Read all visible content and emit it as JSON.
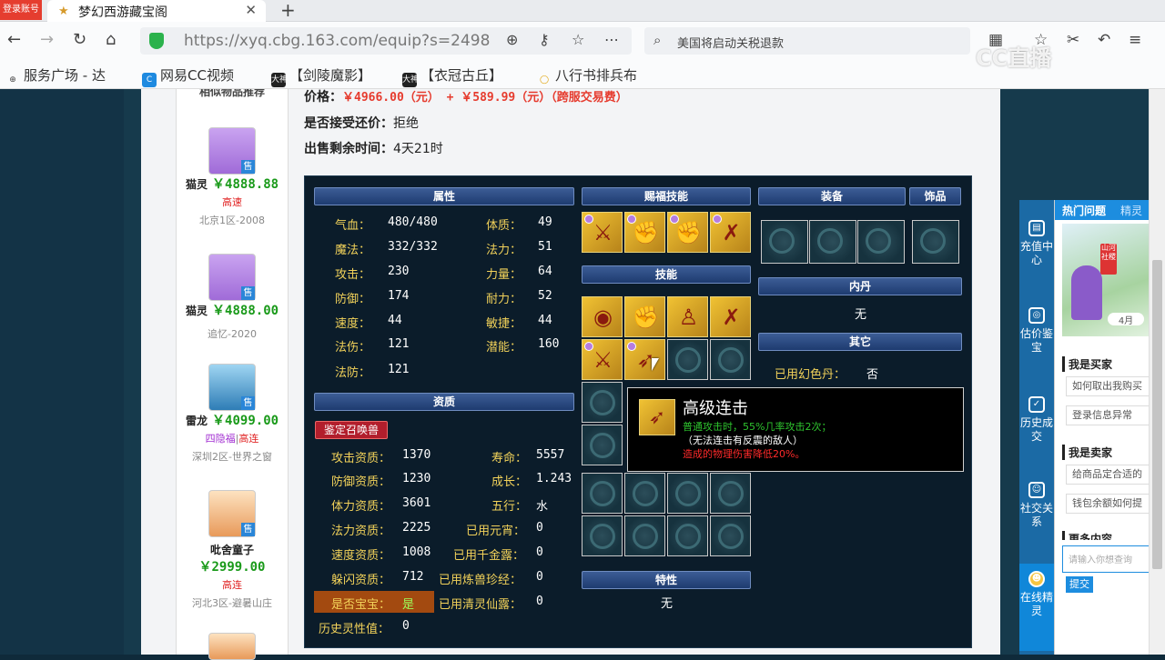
{
  "browser": {
    "corner_badge": "登录账号",
    "tab_title": "梦幻西游藏宝阁",
    "url": "https://xyq.cbg.163.com/equip?s=2498",
    "search_text": "美国将启动关税退款",
    "bookmarks": [
      "服务广场 - 达",
      "网易CC视频",
      "【剑陵魔影】",
      "【衣冠古丘】",
      "八行书排兵布"
    ],
    "bookmark_badge": "大神",
    "watermark": "CC直播"
  },
  "recommend": {
    "heading": "相似物品推荐",
    "sell_badge": "售",
    "items": [
      {
        "name": "猫灵",
        "price": "￥4888.88",
        "tag": "高速",
        "server": "北京1区-2008"
      },
      {
        "name": "猫灵",
        "price": "￥4888.00",
        "tag": "",
        "server": "追忆-2020"
      },
      {
        "name": "雷龙",
        "price": "￥4099.00",
        "tag_purple": "四隐福",
        "tag_sep": "|",
        "tag": "高连",
        "server": "深圳2区-世界之窗"
      },
      {
        "name": "吡舍童子",
        "price": "￥2999.00",
        "tag": "高连",
        "server": "河北3区-避暑山庄"
      }
    ]
  },
  "listing": {
    "price_label": "价格：",
    "price": "￥4966.00（元） + ￥589.99（元）（跨服交易费）",
    "counter_label": "是否接受还价：",
    "counter_value": "拒绝",
    "time_label": "出售剩余时间：",
    "time_value": "4天21时"
  },
  "panel": {
    "headers": {
      "attr": "属性",
      "gift_skills": "赐福技能",
      "equip": "装备",
      "ornament": "饰品",
      "skills": "技能",
      "neidan": "内丹",
      "other": "其它",
      "aptitude": "资质",
      "spirit": "特性"
    },
    "neidan_value": "无",
    "other_label": "已用幻色丹：",
    "other_value": "否",
    "spirit_value": "无",
    "summon_button": "鉴定召唤兽",
    "attrs_left": [
      {
        "label": "气血：",
        "value": "480/480"
      },
      {
        "label": "魔法：",
        "value": "332/332"
      },
      {
        "label": "攻击：",
        "value": "230"
      },
      {
        "label": "防御：",
        "value": "174"
      },
      {
        "label": "速度：",
        "value": "44"
      },
      {
        "label": "法伤：",
        "value": "121"
      },
      {
        "label": "法防：",
        "value": "121"
      }
    ],
    "attrs_right": [
      {
        "label": "体质：",
        "value": "49"
      },
      {
        "label": "法力：",
        "value": "51"
      },
      {
        "label": "力量：",
        "value": "64"
      },
      {
        "label": "耐力：",
        "value": "52"
      },
      {
        "label": "敏捷：",
        "value": "44"
      },
      {
        "label": "潜能：",
        "value": "160"
      }
    ],
    "apt_left": [
      {
        "label": "攻击资质：",
        "value": "1370"
      },
      {
        "label": "防御资质：",
        "value": "1230"
      },
      {
        "label": "体力资质：",
        "value": "3601"
      },
      {
        "label": "法力资质：",
        "value": "2225"
      },
      {
        "label": "速度资质：",
        "value": "1008"
      },
      {
        "label": "躲闪资质：",
        "value": "712"
      },
      {
        "label": "是否宝宝：",
        "value": "是"
      },
      {
        "label": "历史灵性值：",
        "value": "0"
      }
    ],
    "apt_right": [
      {
        "label": "寿命：",
        "value": "5557"
      },
      {
        "label": "成长：",
        "value": "1.243"
      },
      {
        "label": "五行：",
        "value": "水"
      },
      {
        "label": "已用元宵：",
        "value": "0"
      },
      {
        "label": "已用千金露：",
        "value": "0"
      },
      {
        "label": "已用炼兽珍经：",
        "value": "0"
      },
      {
        "label": "已用清灵仙露：",
        "value": "0"
      }
    ]
  },
  "tooltip": {
    "title": "高级连击",
    "line1": "普通攻击时，55%几率攻击2次；",
    "line2": "（无法连击有反震的敌人）",
    "line3": "造成的物理伤害降低20%。"
  },
  "sidenav": [
    {
      "label": "充值中心",
      "icon": "recharge-icon"
    },
    {
      "label": "估价鉴宝",
      "icon": "appraise-icon"
    },
    {
      "label": "历史成交",
      "icon": "history-icon"
    },
    {
      "label": "社交关系",
      "icon": "social-icon"
    },
    {
      "label": "在线精灵",
      "icon": "online-sprite-icon"
    }
  ],
  "faq": {
    "tab_hot": "热门问题",
    "tab_sprite": "精灵",
    "banner_seal": "山河社稷",
    "banner_month": "4月",
    "buyer_heading": "我是买家",
    "buyer_q": [
      "如何取出我购买",
      "登录信息异常"
    ],
    "seller_heading": "我是卖家",
    "seller_q": [
      "给商品定合适的",
      "钱包余额如何提"
    ],
    "more_heading": "更多内容",
    "ask_placeholder": "请输入你想查询",
    "submit": "提交"
  }
}
